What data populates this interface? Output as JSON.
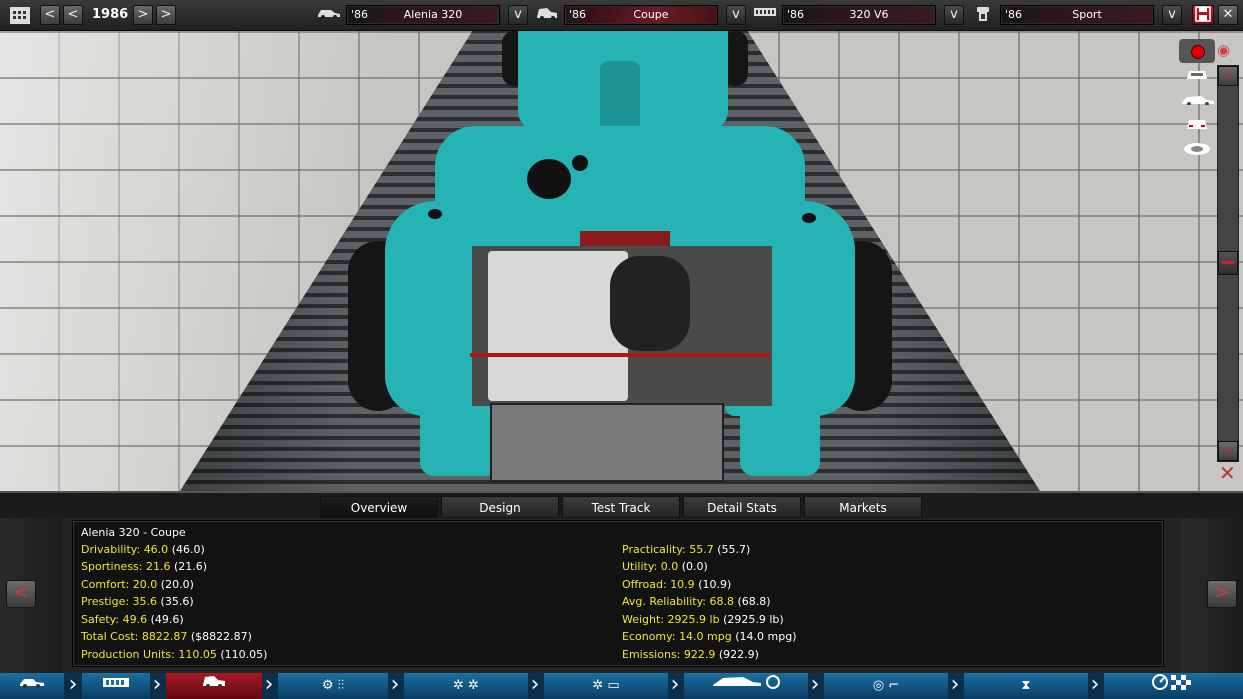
{
  "topbar": {
    "year": "1986",
    "prev_icon": "<",
    "next_icon": ">",
    "dropdown_icon": "v",
    "model": {
      "year": "'86",
      "name": "Alenia 320"
    },
    "trim": {
      "year": "'86",
      "name": "Coupe"
    },
    "engine": {
      "year": "'86",
      "name": "320 V6"
    },
    "variant": {
      "year": "'86",
      "name": "Sport"
    }
  },
  "tabs": [
    "Overview",
    "Design",
    "Test Track",
    "Detail Stats",
    "Markets"
  ],
  "active_tab": "Overview",
  "stats_panel": {
    "title": "Alenia 320 - Coupe",
    "left": [
      {
        "label": "Drivability:",
        "value": "46.0",
        "base": "(46.0)"
      },
      {
        "label": "Sportiness:",
        "value": "21.6",
        "base": "(21.6)"
      },
      {
        "label": "Comfort:",
        "value": "20.0",
        "base": "(20.0)"
      },
      {
        "label": "Prestige:",
        "value": "35.6",
        "base": "(35.6)"
      },
      {
        "label": "Safety:",
        "value": "49.6",
        "base": "(49.6)"
      },
      {
        "label": "Total Cost:",
        "value": "8822.87",
        "base": "($8822.87)"
      },
      {
        "label": "Production Units:",
        "value": "110.05",
        "base": "(110.05)"
      }
    ],
    "right": [
      {
        "label": "Practicality:",
        "value": "55.7",
        "base": "(55.7)"
      },
      {
        "label": "Utility:",
        "value": "0.0",
        "base": "(0.0)"
      },
      {
        "label": "Offroad:",
        "value": "10.9",
        "base": "(10.9)"
      },
      {
        "label": "Avg. Reliability:",
        "value": "68.8",
        "base": "(68.8)"
      },
      {
        "label": "Weight:",
        "value": "2925.9 lb",
        "base": "(2925.9 lb)"
      },
      {
        "label": "Economy:",
        "value": "14.0 mpg",
        "base": "(14.0 mpg)"
      },
      {
        "label": "Emissions:",
        "value": "922.9",
        "base": "(922.9)"
      }
    ],
    "prev_icon": "<",
    "next_icon": ">"
  },
  "bottom_nav": {
    "icons": [
      "car-chassis-icon",
      "engine-block-icon",
      "car-body-icon",
      "gearbox-icon",
      "wheels-icon",
      "brakes-icon",
      "aero-fan-icon",
      "steering-seat-icon",
      "suspension-icon",
      "speedometer-flag-icon"
    ],
    "active_index": 2
  },
  "colors": {
    "accent_red": "#a81a24",
    "stat_yellow": "#f2e438",
    "nav_blue": "#1a6fa3",
    "car_teal": "#25b3b4"
  }
}
